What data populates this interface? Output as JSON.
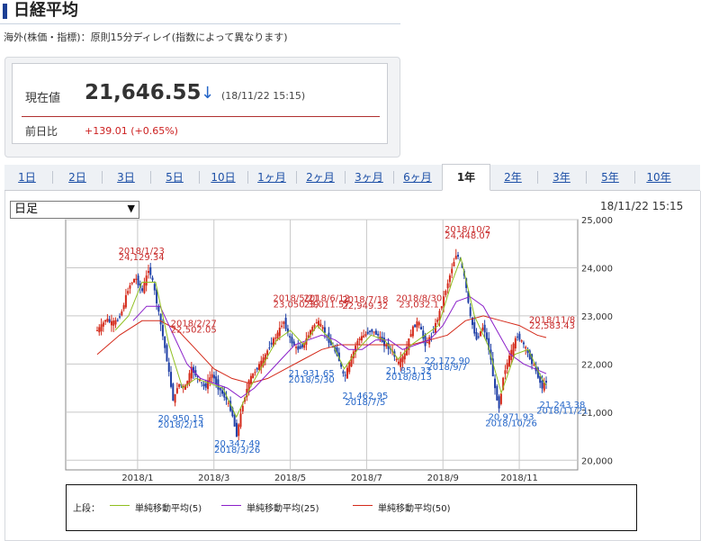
{
  "header": {
    "title": "日経平均"
  },
  "note": "海外(株価・指標)：原則15分ディレイ(指数によって異なります)",
  "quote": {
    "current_label": "現在値",
    "price": "21,646.55",
    "direction_icon": "down-arrow-icon",
    "timestamp": "(18/11/22 15:15)",
    "prev_label": "前日比",
    "change": "+139.01 (+0.65%)",
    "up_color": "#cc1f1f",
    "down_color": "#2566c8"
  },
  "tabs": [
    {
      "label": "1日"
    },
    {
      "label": "2日"
    },
    {
      "label": "3日"
    },
    {
      "label": "5日"
    },
    {
      "label": "10日"
    },
    {
      "label": "1ヶ月"
    },
    {
      "label": "2ヶ月"
    },
    {
      "label": "3ヶ月"
    },
    {
      "label": "6ヶ月"
    },
    {
      "label": "1年",
      "active": true
    },
    {
      "label": "2年"
    },
    {
      "label": "3年"
    },
    {
      "label": "5年"
    },
    {
      "label": "10年"
    }
  ],
  "period_select": {
    "value": "日足"
  },
  "chart_timestamp": "18/11/22 15:15",
  "chart_data": {
    "type": "line",
    "ylim": [
      19800,
      25000
    ],
    "yticks": [
      20000,
      21000,
      22000,
      23000,
      24000,
      25000
    ],
    "ytick_labels": [
      "20,000",
      "21,000",
      "22,000",
      "23,000",
      "24,000",
      "25,000"
    ],
    "xtick_labels": [
      "2018/1",
      "2018/3",
      "2018/5",
      "2018/7",
      "2018/9",
      "2018/11"
    ],
    "grid": true,
    "series": [
      {
        "name": "単純移動平均(5)",
        "color": "#8fbf1f"
      },
      {
        "name": "単純移動平均(25)",
        "color": "#8a1fc9"
      },
      {
        "name": "単純移動平均(50)",
        "color": "#d42a1a"
      }
    ],
    "price_path": [
      [
        0,
        22700
      ],
      [
        0.01,
        22800
      ],
      [
        0.02,
        22950
      ],
      [
        0.03,
        22850
      ],
      [
        0.045,
        22900
      ],
      [
        0.055,
        23100
      ],
      [
        0.07,
        23600
      ],
      [
        0.085,
        23800
      ],
      [
        0.1,
        23500
      ],
      [
        0.115,
        24000
      ],
      [
        0.125,
        23650
      ],
      [
        0.14,
        22900
      ],
      [
        0.155,
        22100
      ],
      [
        0.17,
        21200
      ],
      [
        0.18,
        21600
      ],
      [
        0.195,
        21500
      ],
      [
        0.21,
        21900
      ],
      [
        0.225,
        21700
      ],
      [
        0.24,
        21500
      ],
      [
        0.255,
        21800
      ],
      [
        0.27,
        21500
      ],
      [
        0.285,
        21300
      ],
      [
        0.3,
        21000
      ],
      [
        0.31,
        20500
      ],
      [
        0.325,
        21200
      ],
      [
        0.34,
        21700
      ],
      [
        0.355,
        21900
      ],
      [
        0.37,
        22100
      ],
      [
        0.385,
        22400
      ],
      [
        0.4,
        22600
      ],
      [
        0.415,
        22900
      ],
      [
        0.43,
        22500
      ],
      [
        0.445,
        22300
      ],
      [
        0.46,
        22400
      ],
      [
        0.475,
        22700
      ],
      [
        0.49,
        22900
      ],
      [
        0.505,
        22700
      ],
      [
        0.52,
        22400
      ],
      [
        0.535,
        22200
      ],
      [
        0.55,
        21700
      ],
      [
        0.565,
        22100
      ],
      [
        0.58,
        22500
      ],
      [
        0.595,
        22600
      ],
      [
        0.61,
        22700
      ],
      [
        0.625,
        22600
      ],
      [
        0.64,
        22400
      ],
      [
        0.655,
        22300
      ],
      [
        0.67,
        22000
      ],
      [
        0.685,
        22200
      ],
      [
        0.7,
        22700
      ],
      [
        0.715,
        22900
      ],
      [
        0.73,
        22400
      ],
      [
        0.745,
        22600
      ],
      [
        0.76,
        23000
      ],
      [
        0.775,
        23500
      ],
      [
        0.79,
        24000
      ],
      [
        0.8,
        24300
      ],
      [
        0.81,
        24100
      ],
      [
        0.82,
        23700
      ],
      [
        0.83,
        23000
      ],
      [
        0.845,
        22500
      ],
      [
        0.86,
        22800
      ],
      [
        0.875,
        22200
      ],
      [
        0.885,
        21500
      ],
      [
        0.895,
        21100
      ],
      [
        0.905,
        21800
      ],
      [
        0.92,
        22200
      ],
      [
        0.935,
        22600
      ],
      [
        0.95,
        22400
      ],
      [
        0.965,
        22100
      ],
      [
        0.98,
        21800
      ],
      [
        0.99,
        21500
      ],
      [
        1,
        21650
      ]
    ],
    "ma5": [
      [
        0.04,
        22700
      ],
      [
        0.07,
        23000
      ],
      [
        0.1,
        23700
      ],
      [
        0.13,
        23700
      ],
      [
        0.16,
        22400
      ],
      [
        0.19,
        21500
      ],
      [
        0.22,
        21700
      ],
      [
        0.25,
        21600
      ],
      [
        0.28,
        21500
      ],
      [
        0.31,
        20900
      ],
      [
        0.34,
        21500
      ],
      [
        0.37,
        22000
      ],
      [
        0.4,
        22500
      ],
      [
        0.43,
        22700
      ],
      [
        0.46,
        22400
      ],
      [
        0.49,
        22800
      ],
      [
        0.52,
        22500
      ],
      [
        0.55,
        21900
      ],
      [
        0.58,
        22300
      ],
      [
        0.61,
        22600
      ],
      [
        0.64,
        22500
      ],
      [
        0.67,
        22100
      ],
      [
        0.7,
        22400
      ],
      [
        0.73,
        22600
      ],
      [
        0.76,
        22800
      ],
      [
        0.79,
        23700
      ],
      [
        0.81,
        24200
      ],
      [
        0.84,
        23000
      ],
      [
        0.87,
        22400
      ],
      [
        0.9,
        21400
      ],
      [
        0.93,
        22200
      ],
      [
        0.96,
        22300
      ],
      [
        0.99,
        21700
      ],
      [
        1,
        21550
      ]
    ],
    "ma25": [
      [
        0.08,
        22900
      ],
      [
        0.11,
        23200
      ],
      [
        0.14,
        23200
      ],
      [
        0.17,
        22600
      ],
      [
        0.2,
        22000
      ],
      [
        0.23,
        21700
      ],
      [
        0.26,
        21600
      ],
      [
        0.29,
        21500
      ],
      [
        0.32,
        21300
      ],
      [
        0.35,
        21500
      ],
      [
        0.38,
        21800
      ],
      [
        0.41,
        22100
      ],
      [
        0.44,
        22400
      ],
      [
        0.47,
        22500
      ],
      [
        0.5,
        22600
      ],
      [
        0.53,
        22500
      ],
      [
        0.56,
        22300
      ],
      [
        0.59,
        22300
      ],
      [
        0.62,
        22500
      ],
      [
        0.65,
        22500
      ],
      [
        0.68,
        22300
      ],
      [
        0.71,
        22400
      ],
      [
        0.74,
        22500
      ],
      [
        0.77,
        22800
      ],
      [
        0.8,
        23300
      ],
      [
        0.83,
        23400
      ],
      [
        0.86,
        23200
      ],
      [
        0.89,
        22700
      ],
      [
        0.92,
        22200
      ],
      [
        0.95,
        22000
      ],
      [
        1,
        21800
      ]
    ],
    "ma50": [
      [
        0.0,
        22200
      ],
      [
        0.05,
        22600
      ],
      [
        0.1,
        22900
      ],
      [
        0.14,
        22900
      ],
      [
        0.18,
        22700
      ],
      [
        0.22,
        22300
      ],
      [
        0.26,
        21900
      ],
      [
        0.3,
        21700
      ],
      [
        0.34,
        21600
      ],
      [
        0.38,
        21700
      ],
      [
        0.42,
        21900
      ],
      [
        0.46,
        22100
      ],
      [
        0.5,
        22300
      ],
      [
        0.54,
        22400
      ],
      [
        0.58,
        22400
      ],
      [
        0.62,
        22400
      ],
      [
        0.66,
        22400
      ],
      [
        0.7,
        22400
      ],
      [
        0.74,
        22500
      ],
      [
        0.78,
        22600
      ],
      [
        0.82,
        22900
      ],
      [
        0.86,
        23000
      ],
      [
        0.9,
        22900
      ],
      [
        0.94,
        22800
      ],
      [
        0.98,
        22600
      ],
      [
        1,
        22550
      ]
    ],
    "annotations": [
      {
        "text": "2018/1/23",
        "color": "red",
        "fx": 0.148,
        "fy": 0.1
      },
      {
        "text": "24,129.34",
        "color": "red",
        "fx": 0.148,
        "fy": 0.125
      },
      {
        "text": "2018/2/27",
        "color": "red",
        "fx": 0.25,
        "fy": 0.39
      },
      {
        "text": "22,502.05",
        "color": "red",
        "fx": 0.25,
        "fy": 0.415
      },
      {
        "text": "2018/5/21",
        "color": "red",
        "fx": 0.45,
        "fy": 0.29
      },
      {
        "text": "23,050.39",
        "color": "red",
        "fx": 0.45,
        "fy": 0.315
      },
      {
        "text": "2018/6/12",
        "color": "red",
        "fx": 0.51,
        "fy": 0.29
      },
      {
        "text": "23,011.57",
        "color": "red",
        "fx": 0.51,
        "fy": 0.315
      },
      {
        "text": "2018/7/18",
        "color": "red",
        "fx": 0.585,
        "fy": 0.295
      },
      {
        "text": "22,949.32",
        "color": "red",
        "fx": 0.585,
        "fy": 0.32
      },
      {
        "text": "2018/8/30",
        "color": "red",
        "fx": 0.69,
        "fy": 0.29
      },
      {
        "text": "23,032.1",
        "color": "red",
        "fx": 0.69,
        "fy": 0.315
      },
      {
        "text": "2018/10/2",
        "color": "red",
        "fx": 0.785,
        "fy": 0.015
      },
      {
        "text": "24,448.07",
        "color": "red",
        "fx": 0.785,
        "fy": 0.04
      },
      {
        "text": "2018/11/8",
        "color": "red",
        "fx": 0.95,
        "fy": 0.375
      },
      {
        "text": "22,583.43",
        "color": "red",
        "fx": 0.95,
        "fy": 0.4
      },
      {
        "text": "20,950.15",
        "color": "blue",
        "fx": 0.225,
        "fy": 0.77
      },
      {
        "text": "2018/2/14",
        "color": "blue",
        "fx": 0.225,
        "fy": 0.795
      },
      {
        "text": "20,347.49",
        "color": "blue",
        "fx": 0.335,
        "fy": 0.87
      },
      {
        "text": "2018/3/26",
        "color": "blue",
        "fx": 0.335,
        "fy": 0.895
      },
      {
        "text": "21,931.65",
        "color": "blue",
        "fx": 0.48,
        "fy": 0.59
      },
      {
        "text": "2018/5/30",
        "color": "blue",
        "fx": 0.48,
        "fy": 0.615
      },
      {
        "text": "21,462.95",
        "color": "blue",
        "fx": 0.585,
        "fy": 0.68
      },
      {
        "text": "2018/7/5",
        "color": "blue",
        "fx": 0.585,
        "fy": 0.705
      },
      {
        "text": "21,851.32",
        "color": "blue",
        "fx": 0.67,
        "fy": 0.58
      },
      {
        "text": "2018/8/13",
        "color": "blue",
        "fx": 0.67,
        "fy": 0.605
      },
      {
        "text": "22,172.90",
        "color": "blue",
        "fx": 0.745,
        "fy": 0.54
      },
      {
        "text": "2018/9/7",
        "color": "blue",
        "fx": 0.745,
        "fy": 0.565
      },
      {
        "text": "20,971.93",
        "color": "blue",
        "fx": 0.87,
        "fy": 0.765
      },
      {
        "text": "2018/10/26",
        "color": "blue",
        "fx": 0.87,
        "fy": 0.79
      },
      {
        "text": "21,243.38",
        "color": "blue",
        "fx": 0.97,
        "fy": 0.715
      },
      {
        "text": "2018/11/21",
        "color": "blue",
        "fx": 0.97,
        "fy": 0.74
      }
    ]
  },
  "legend": {
    "prefix": "上段：",
    "items": [
      {
        "label": "単純移動平均(5)",
        "color": "#8fbf1f"
      },
      {
        "label": "単純移動平均(25)",
        "color": "#8a1fc9"
      },
      {
        "label": "単純移動平均(50)",
        "color": "#d42a1a"
      }
    ]
  }
}
